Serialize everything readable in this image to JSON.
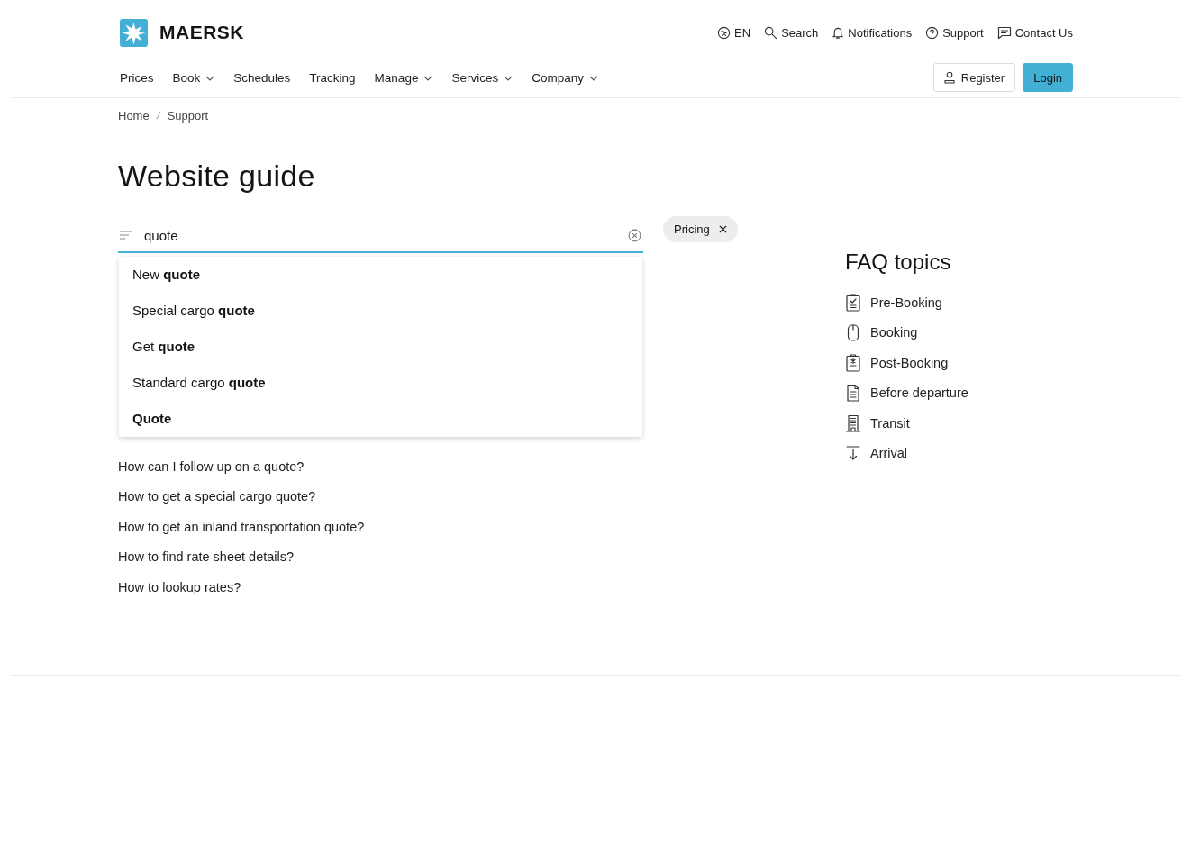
{
  "header": {
    "logo": "MAERSK",
    "utility_links": [
      "EN",
      "Search",
      "Notifications",
      "Support",
      "Contact Us"
    ],
    "nav": [
      {
        "label": "Prices",
        "has_menu": false
      },
      {
        "label": "Book",
        "has_menu": true
      },
      {
        "label": "Schedules",
        "has_menu": false
      },
      {
        "label": "Tracking",
        "has_menu": false
      },
      {
        "label": "Manage",
        "has_menu": true
      },
      {
        "label": "Services",
        "has_menu": true
      },
      {
        "label": "Company",
        "has_menu": true
      }
    ],
    "buttons": [
      {
        "label": "Register",
        "kind": "secondary"
      },
      {
        "label": "Login",
        "kind": "primary"
      }
    ]
  },
  "breadcrumb": [
    "Home",
    "Support"
  ],
  "title": "Website guide",
  "search": {
    "value": "quote",
    "suggestions": [
      {
        "text": "New **quote**",
        "kind": "partial"
      },
      {
        "text": "Special cargo **quote**",
        "kind": "partial"
      },
      {
        "text": "Get **quote**",
        "kind": "partial"
      },
      {
        "text": "Standard cargo **quote**",
        "kind": "partial"
      },
      {
        "text": "Quote",
        "kind": "full_match"
      }
    ]
  },
  "filter_chip": {
    "label": "Pricing"
  },
  "faq_list": [
    "How can I follow up on a quote?",
    "How to get a special cargo quote?",
    "How to get an inland transportation quote?",
    "How to find rate sheet details?",
    "How to lookup rates?"
  ],
  "faq_topics": {
    "heading": "FAQ topics",
    "items": [
      "Pre-Booking",
      "Booking",
      "Post-Booking",
      "Before departure",
      "Transit",
      "Arrival"
    ]
  }
}
